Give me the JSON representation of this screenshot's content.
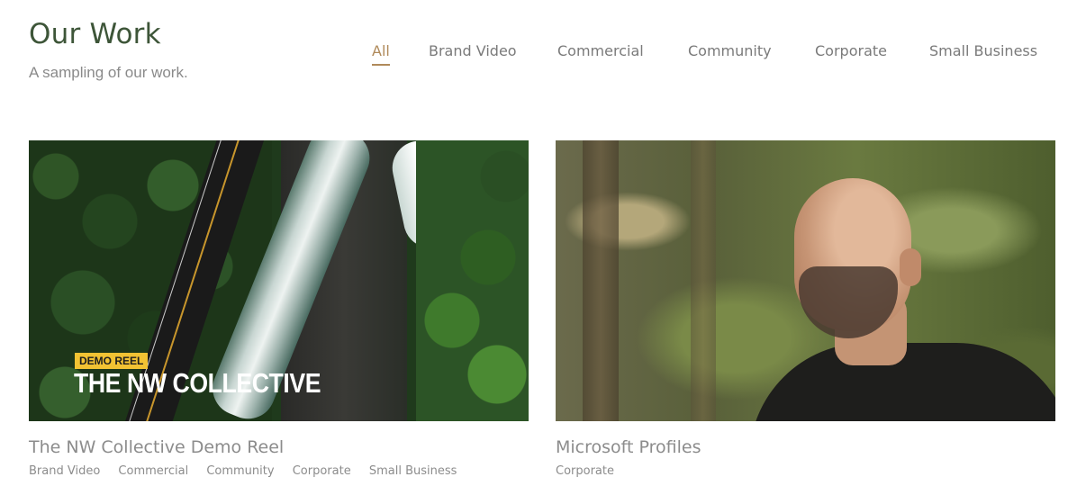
{
  "header": {
    "title": "Our Work",
    "subtitle": "A sampling of our work."
  },
  "filters": {
    "active": "All",
    "items": [
      "All",
      "Brand Video",
      "Commercial",
      "Community",
      "Corporate",
      "Small Business"
    ]
  },
  "colors": {
    "title": "#3d5538",
    "active_filter": "#b08a5a",
    "badge": "#f2c233"
  },
  "cards": [
    {
      "title": "The NW Collective Demo Reel",
      "thumbnail_badge": "DEMO REEL",
      "thumbnail_text": "THE NW COLLECTIVE",
      "tags": [
        "Brand Video",
        "Commercial",
        "Community",
        "Corporate",
        "Small Business"
      ]
    },
    {
      "title": "Microsoft Profiles",
      "tags": [
        "Corporate"
      ]
    }
  ]
}
